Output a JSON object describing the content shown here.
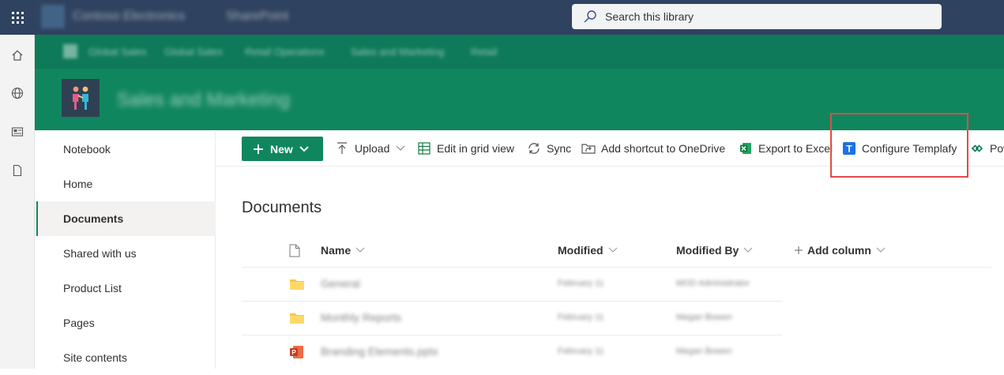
{
  "suite_bar": {
    "org_name": "Contoso Electronics",
    "app_name": "SharePoint",
    "search_placeholder": "Search this library"
  },
  "app_rail": {
    "icons": [
      "home-icon",
      "globe-icon",
      "news-icon",
      "file-icon"
    ]
  },
  "hub_nav": {
    "items": [
      "Global Sales",
      "Global Sales",
      "Retail Operations",
      "Sales and Marketing",
      "Retail"
    ]
  },
  "site": {
    "title": "Sales and Marketing"
  },
  "left_nav": {
    "items": [
      {
        "label": "Notebook",
        "selected": false
      },
      {
        "label": "Home",
        "selected": false
      },
      {
        "label": "Documents",
        "selected": true
      },
      {
        "label": "Shared with us",
        "selected": false
      },
      {
        "label": "Product List",
        "selected": false
      },
      {
        "label": "Pages",
        "selected": false
      },
      {
        "label": "Site contents",
        "selected": false
      }
    ]
  },
  "command_bar": {
    "new_label": "New",
    "upload_label": "Upload",
    "grid_label": "Edit in grid view",
    "sync_label": "Sync",
    "shortcut_label": "Add shortcut to OneDrive",
    "export_label": "Export to Excel",
    "templafy_label": "Configure Templafy",
    "templafy_icon_letter": "T",
    "overflow_label": "Pow"
  },
  "library": {
    "title": "Documents",
    "columns": {
      "name": "Name",
      "modified": "Modified",
      "modified_by": "Modified By",
      "add_column": "Add column"
    },
    "rows": [
      {
        "type": "folder",
        "name": "General",
        "modified": "February 11",
        "modified_by": "MOD Administrator"
      },
      {
        "type": "folder",
        "name": "Monthly Reports",
        "modified": "February 11",
        "modified_by": "Megan Bowen"
      },
      {
        "type": "pptx",
        "name": "Branding Elements.pptx",
        "modified": "February 11",
        "modified_by": "Megan Bowen"
      }
    ]
  },
  "colors": {
    "suite_bar": "#2f4260",
    "hub_nav": "#0e7a59",
    "site_header": "#10865f",
    "accent": "#10865f",
    "highlight_box": "#e24a47",
    "templafy_blue": "#1a73e8"
  }
}
